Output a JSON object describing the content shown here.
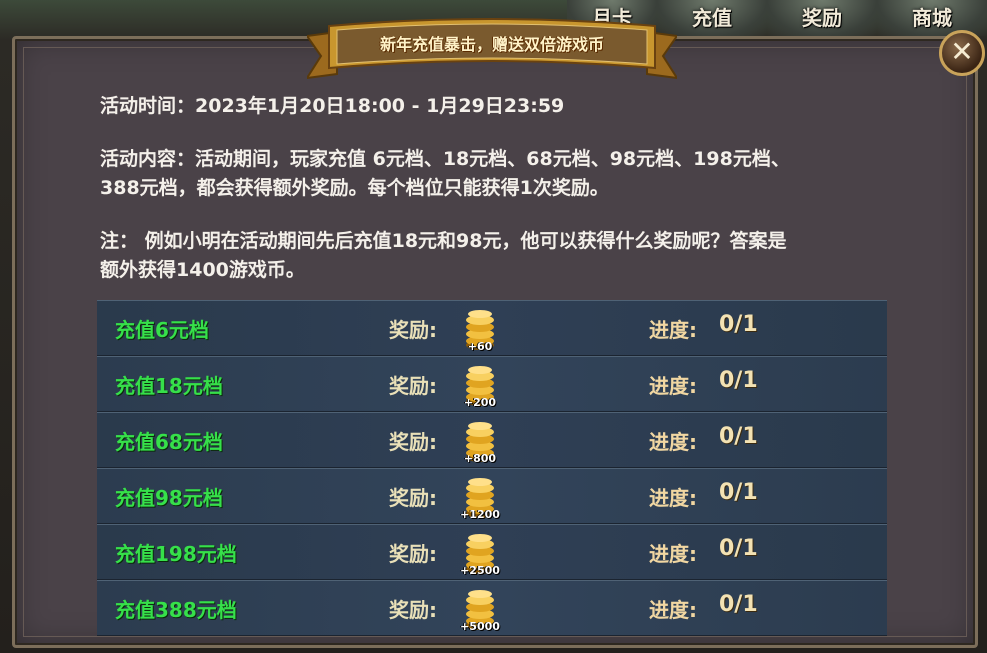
{
  "top_tabs": [
    {
      "label": "月卡"
    },
    {
      "label": "充值"
    },
    {
      "label": "奖励"
    },
    {
      "label": "商城"
    }
  ],
  "banner": {
    "title": "新年充值暴击，赠送双倍游戏币"
  },
  "close": {
    "label": "✕"
  },
  "info": {
    "time": "活动时间：2023年1月20日18:00 - 1月29日23:59",
    "content_line1": "活动内容：活动期间，玩家充值 6元档、18元档、68元档、98元档、198元档、",
    "content_line2": "388元档，都会获得额外奖励。每个档位只能获得1次奖励。",
    "note_line1": "注： 例如小明在活动期间先后充值18元和98元，他可以获得什么奖励呢？答案是",
    "note_line2": "额外获得1400游戏币。"
  },
  "rows": [
    {
      "tier": "充值6元档",
      "reward_label": "奖励:",
      "coin_amount": "+60",
      "progress_label": "进度:",
      "progress": "0/1"
    },
    {
      "tier": "充值18元档",
      "reward_label": "奖励:",
      "coin_amount": "+200",
      "progress_label": "进度:",
      "progress": "0/1"
    },
    {
      "tier": "充值68元档",
      "reward_label": "奖励:",
      "coin_amount": "+800",
      "progress_label": "进度:",
      "progress": "0/1"
    },
    {
      "tier": "充值98元档",
      "reward_label": "奖励:",
      "coin_amount": "+1200",
      "progress_label": "进度:",
      "progress": "0/1"
    },
    {
      "tier": "充值198元档",
      "reward_label": "奖励:",
      "coin_amount": "+2500",
      "progress_label": "进度:",
      "progress": "0/1"
    },
    {
      "tier": "充值388元档",
      "reward_label": "奖励:",
      "coin_amount": "+5000",
      "progress_label": "进度:",
      "progress": "0/1"
    }
  ],
  "colors": {
    "panel_bg": "#4a4248",
    "tier_green": "#36e04a",
    "banner_gold": "#c8962e"
  },
  "icons": {
    "coin": "gold-coin-stack-icon",
    "close": "close-icon"
  }
}
